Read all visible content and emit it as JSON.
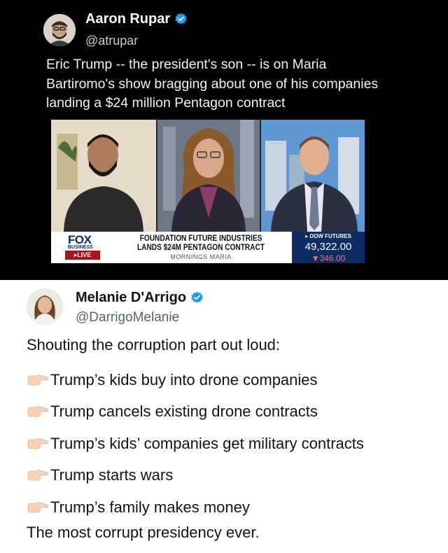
{
  "top_tweet": {
    "author_name": "Aaron Rupar",
    "handle": "@atrupar",
    "text_lines": [
      "Eric Trump -- the president's son -- is on Maria",
      "Bartiromo's show bragging about one of his companies",
      "landing a $24 million Pentagon contract"
    ],
    "media": {
      "network_logo": "FOX",
      "network_sub": "BUSINESS",
      "live_label": "LIVE",
      "headline_lines": [
        "FOUNDATION FUTURE INDUSTRIES",
        "LANDS $24M PENTAGON CONTRACT"
      ],
      "show_name": "MORNINGS MARIA",
      "ticker_label": "DOW FUTURES",
      "ticker_value": "49,322.00",
      "ticker_change": "▼346.00"
    }
  },
  "bottom_tweet": {
    "author_name": "Melanie D'Arrigo",
    "handle": "@DarrigoMelanie",
    "intro": "Shouting the corruption part out loud:",
    "bullets": [
      "Trump’s kids buy into drone companies",
      "Trump cancels existing drone contracts",
      "Trump’s kids’ companies get military contracts",
      "Trump starts wars",
      "Trump’s family makes money"
    ],
    "outro": "The most corrupt presidency ever."
  },
  "icons": {
    "verified": "verified-badge-icon",
    "bullet": "pointing-hand-icon"
  },
  "colors": {
    "verified_blue": "#1d9bf0",
    "fox_navy": "#0a2a66",
    "live_red": "#b0121b",
    "ticker_bg": "#0d2c63"
  }
}
